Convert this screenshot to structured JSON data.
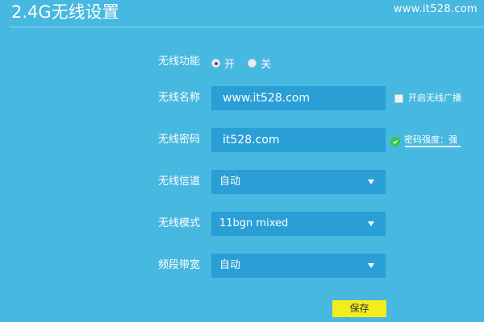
{
  "header": {
    "title": "2.4G无线设置",
    "watermark": "www.it528.com"
  },
  "form": {
    "wireless_function": {
      "label": "无线功能",
      "options": [
        {
          "label": "开",
          "checked": true
        },
        {
          "label": "关",
          "checked": false
        }
      ]
    },
    "ssid": {
      "label": "无线名称",
      "value": "www.it528.com",
      "broadcast_label": "开启无线广播",
      "broadcast_checked": false
    },
    "password": {
      "label": "无线密码",
      "value": "it528.com",
      "strength_text": "密码强度：强",
      "strength_color": "#37c54a"
    },
    "channel": {
      "label": "无线信道",
      "value": "自动"
    },
    "mode": {
      "label": "无线模式",
      "value": "11bgn mixed"
    },
    "bandwidth": {
      "label": "频段带宽",
      "value": "自动"
    },
    "save_label": "保存"
  },
  "colors": {
    "background": "#47b8df",
    "field": "#2a9fd6",
    "save_button": "#f5ec1d"
  }
}
